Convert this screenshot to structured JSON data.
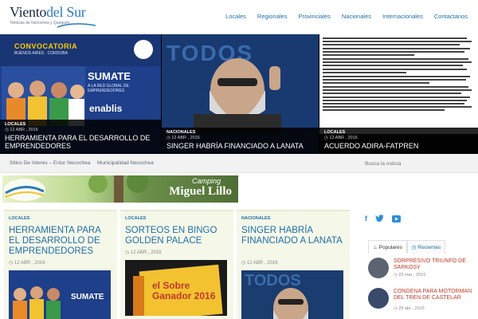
{
  "site": {
    "logo_main": "Viento",
    "logo_accent": "del Sur",
    "logo_sub": "Noticias de Necochea y Quequén"
  },
  "nav": [
    "Locales",
    "Regionales",
    "Provinciales",
    "Nacionales",
    "Internacionales",
    "Contactanos"
  ],
  "slider": [
    {
      "category": "LOCALES",
      "date": "12 ABR , 2016",
      "title": "HERRAMIENTA PARA EL DESARROLLO DE EMPRENDEDORES",
      "ad": {
        "convocatoria": "CONVOCATORIA",
        "convocatoria_sub": "BUENOS AIRES · CORDOBA",
        "sumate": "SUMATE",
        "sumate_sub": "A LA RED GLOBAL DE EMPRENDEDORES",
        "brand": "enablis"
      }
    },
    {
      "category": "NACIONALES",
      "date": "12 ABR , 2016",
      "title": "SINGER HABRÍA FINANCIADO A LANATA",
      "bg_text": "TODOS"
    },
    {
      "category": "LOCALES",
      "date": "12 ABR , 2016",
      "title": "ACUERDO ADIRA-FATPREN"
    }
  ],
  "links": [
    "Sitios De Interes – Entur Necochea",
    "Municipalidad Necochea"
  ],
  "search_placeholder": "Busca la noticia",
  "banner": {
    "line1": "Camping",
    "line2": "Miguel Lillo"
  },
  "articles": [
    {
      "category": "LOCALES",
      "title": "HERRAMIENTA PARA EL DESARROLLO DE EMPRENDEDORES",
      "date": "12 ABR , 2016",
      "img_text": "SUMATE"
    },
    {
      "category": "LOCALES",
      "title": "SORTEOS EN BINGO GOLDEN PALACE",
      "date": "12 ABR , 2016",
      "img_text": "el Sobre Ganador 2016"
    },
    {
      "category": "NACIONALES",
      "title": "SINGER HABRÍA FINANCIADO A LANATA",
      "date": "12 ABR , 2016",
      "img_text": "TODOS"
    }
  ],
  "sidebar": {
    "social": [
      "f",
      "t",
      "yt"
    ],
    "tabs": [
      "Populares",
      "Recientes"
    ],
    "items": [
      {
        "title": "SORPRESIVO TRIUNFO DE SARKOSY",
        "date": "23 mar , 2015"
      },
      {
        "title": "CONDENA PARA MOTORMAN DEL TREN DE CASTELAR",
        "date": "29 abr , 2015"
      }
    ]
  },
  "colors": {
    "nav": "#1e6fa8",
    "accent": "#2b7bb9",
    "sidebar_title": "#c0392b"
  }
}
